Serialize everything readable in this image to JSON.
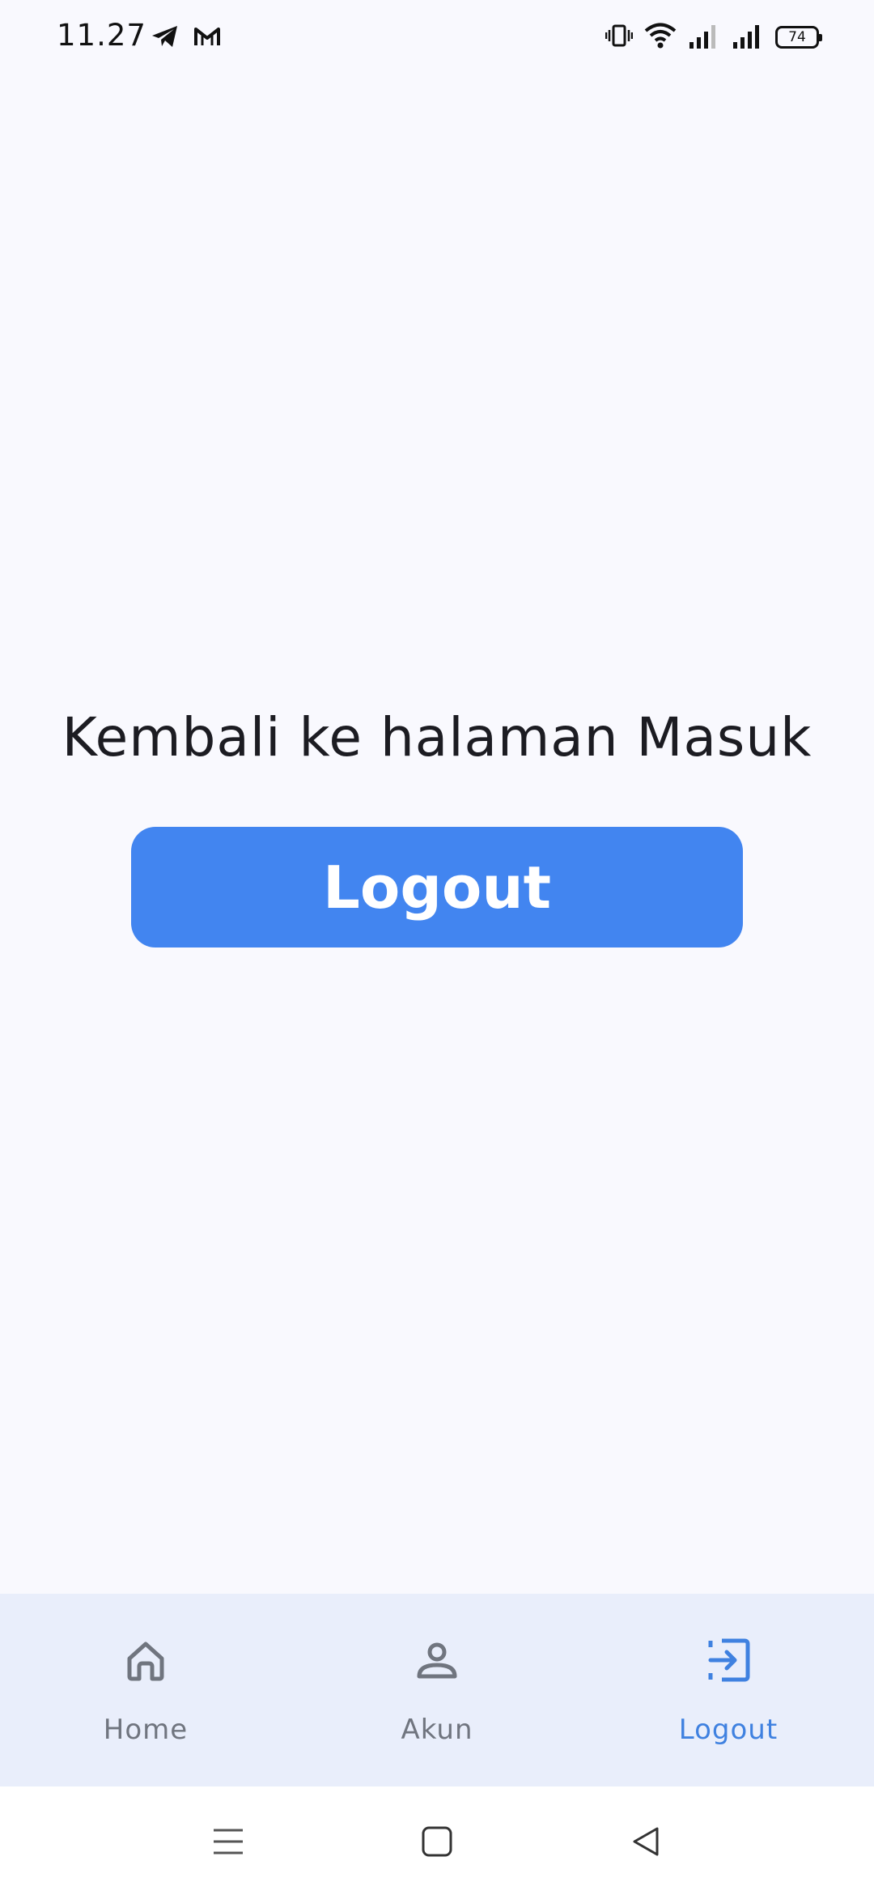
{
  "status_bar": {
    "time": "11.27",
    "battery_level": "74",
    "left_icons": [
      "telegram-icon",
      "gmail-icon"
    ],
    "right_icons": [
      "vibrate-icon",
      "wifi-icon",
      "signal-icon",
      "signal-icon"
    ]
  },
  "main": {
    "message": "Kembali ke halaman Masuk",
    "logout_button_label": "Logout"
  },
  "bottom_nav": {
    "items": [
      {
        "label": "Home",
        "icon": "home-icon",
        "active": false
      },
      {
        "label": "Akun",
        "icon": "person-icon",
        "active": false
      },
      {
        "label": "Logout",
        "icon": "logout-icon",
        "active": true
      }
    ]
  },
  "system_nav": {
    "buttons": [
      "menu-icon",
      "home-square-icon",
      "back-triangle-icon"
    ]
  },
  "colors": {
    "background": "#f9f9fe",
    "primary": "#4285f0",
    "nav_background": "#e9eefb",
    "nav_active": "#3f81e0",
    "nav_inactive": "#70757f"
  }
}
